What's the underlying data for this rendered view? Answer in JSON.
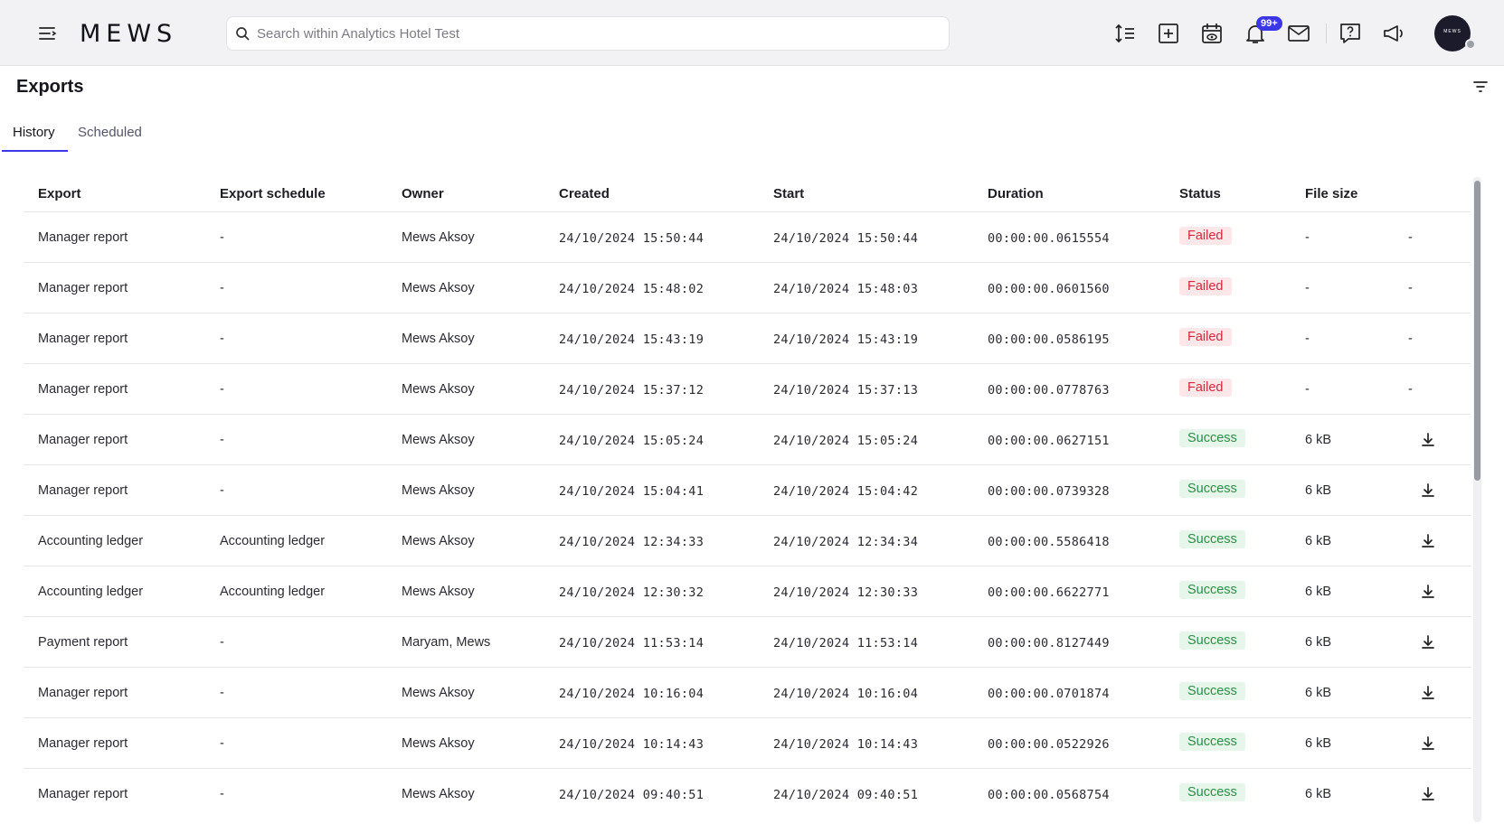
{
  "header": {
    "logo": "MEWS",
    "search_placeholder": "Search within Analytics Hotel Test",
    "notifications_badge": "99+",
    "avatar_text": "MEWS",
    "icons": [
      "menu-icon",
      "sort-icon",
      "add-icon",
      "calendar-view-icon",
      "bell-icon",
      "mail-icon",
      "help-icon",
      "announcement-icon"
    ]
  },
  "page": {
    "title": "Exports",
    "tabs": [
      {
        "label": "History",
        "active": true
      },
      {
        "label": "Scheduled",
        "active": false
      }
    ]
  },
  "table": {
    "columns": [
      "Export",
      "Export schedule",
      "Owner",
      "Created",
      "Start",
      "Duration",
      "Status",
      "File size"
    ],
    "rows": [
      {
        "export": "Manager report",
        "schedule": "-",
        "owner": "Mews Aksoy",
        "created": "24/10/2024 15:50:44",
        "start": "24/10/2024 15:50:44",
        "duration": "00:00:00.0615554",
        "status": "Failed",
        "size": "-",
        "action": "-"
      },
      {
        "export": "Manager report",
        "schedule": "-",
        "owner": "Mews Aksoy",
        "created": "24/10/2024 15:48:02",
        "start": "24/10/2024 15:48:03",
        "duration": "00:00:00.0601560",
        "status": "Failed",
        "size": "-",
        "action": "-"
      },
      {
        "export": "Manager report",
        "schedule": "-",
        "owner": "Mews Aksoy",
        "created": "24/10/2024 15:43:19",
        "start": "24/10/2024 15:43:19",
        "duration": "00:00:00.0586195",
        "status": "Failed",
        "size": "-",
        "action": "-"
      },
      {
        "export": "Manager report",
        "schedule": "-",
        "owner": "Mews Aksoy",
        "created": "24/10/2024 15:37:12",
        "start": "24/10/2024 15:37:13",
        "duration": "00:00:00.0778763",
        "status": "Failed",
        "size": "-",
        "action": "-"
      },
      {
        "export": "Manager report",
        "schedule": "-",
        "owner": "Mews Aksoy",
        "created": "24/10/2024 15:05:24",
        "start": "24/10/2024 15:05:24",
        "duration": "00:00:00.0627151",
        "status": "Success",
        "size": "6 kB",
        "action": "download"
      },
      {
        "export": "Manager report",
        "schedule": "-",
        "owner": "Mews Aksoy",
        "created": "24/10/2024 15:04:41",
        "start": "24/10/2024 15:04:42",
        "duration": "00:00:00.0739328",
        "status": "Success",
        "size": "6 kB",
        "action": "download"
      },
      {
        "export": "Accounting ledger",
        "schedule": "Accounting ledger",
        "owner": "Mews Aksoy",
        "created": "24/10/2024 12:34:33",
        "start": "24/10/2024 12:34:34",
        "duration": "00:00:00.5586418",
        "status": "Success",
        "size": "6 kB",
        "action": "download"
      },
      {
        "export": "Accounting ledger",
        "schedule": "Accounting ledger",
        "owner": "Mews Aksoy",
        "created": "24/10/2024 12:30:32",
        "start": "24/10/2024 12:30:33",
        "duration": "00:00:00.6622771",
        "status": "Success",
        "size": "6 kB",
        "action": "download"
      },
      {
        "export": "Payment report",
        "schedule": "-",
        "owner": "Maryam, Mews",
        "created": "24/10/2024 11:53:14",
        "start": "24/10/2024 11:53:14",
        "duration": "00:00:00.8127449",
        "status": "Success",
        "size": "6 kB",
        "action": "download"
      },
      {
        "export": "Manager report",
        "schedule": "-",
        "owner": "Mews Aksoy",
        "created": "24/10/2024 10:16:04",
        "start": "24/10/2024 10:16:04",
        "duration": "00:00:00.0701874",
        "status": "Success",
        "size": "6 kB",
        "action": "download"
      },
      {
        "export": "Manager report",
        "schedule": "-",
        "owner": "Mews Aksoy",
        "created": "24/10/2024 10:14:43",
        "start": "24/10/2024 10:14:43",
        "duration": "00:00:00.0522926",
        "status": "Success",
        "size": "6 kB",
        "action": "download"
      },
      {
        "export": "Manager report",
        "schedule": "-",
        "owner": "Mews Aksoy",
        "created": "24/10/2024 09:40:51",
        "start": "24/10/2024 09:40:51",
        "duration": "00:00:00.0568754",
        "status": "Success",
        "size": "6 kB",
        "action": "download"
      }
    ]
  },
  "colors": {
    "accent": "#3c37e6",
    "failed_bg": "#fde7e9",
    "failed_text": "#d22a3b",
    "success_bg": "#e6f6ea",
    "success_text": "#2d8d46"
  }
}
